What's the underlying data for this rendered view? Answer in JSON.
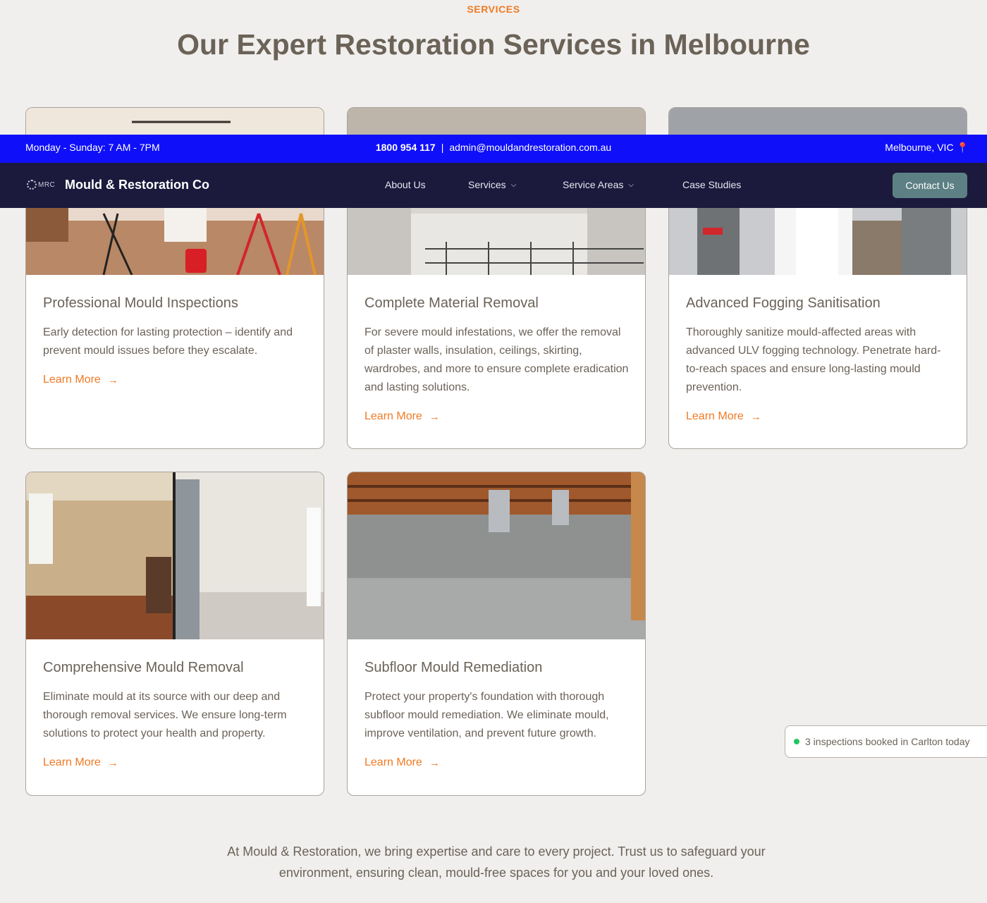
{
  "section": {
    "eyebrow": "SERVICES",
    "headline": "Our Expert Restoration Services in Melbourne"
  },
  "topbar": {
    "hours": "Monday - Sunday: 7 AM - 7PM",
    "phone": "1800 954 117",
    "separator": "|",
    "email": "admin@mouldandrestoration.com.au",
    "location": "Melbourne, VIC",
    "location_icon": "map-pin-icon"
  },
  "navbar": {
    "logo_text": "MRC",
    "brand": "Mould & Restoration Co",
    "items": [
      {
        "label": "About Us",
        "dropdown": false
      },
      {
        "label": "Services",
        "dropdown": true
      },
      {
        "label": "Service Areas",
        "dropdown": true
      },
      {
        "label": "Case Studies",
        "dropdown": false
      }
    ],
    "cta": "Contact Us",
    "chevron": "⌄"
  },
  "services": [
    {
      "title": "Professional Mould Inspections",
      "description": "Early detection for lasting protection – identify and prevent mould issues before they escalate.",
      "link": "Learn More"
    },
    {
      "title": "Complete Material Removal",
      "description": "For severe mould infestations, we offer the removal of plaster walls, insulation, ceilings, skirting, wardrobes, and more to ensure complete eradication and lasting solutions.",
      "link": "Learn More"
    },
    {
      "title": "Advanced Fogging Sanitisation",
      "description": "Thoroughly sanitize mould-affected areas with advanced ULV fogging technology. Penetrate hard-to-reach spaces and ensure long-lasting mould prevention.",
      "link": "Learn More"
    },
    {
      "title": "Comprehensive Mould Removal",
      "description": "Eliminate mould at its source with our deep and thorough removal services. We ensure long-term solutions to protect your health and property.",
      "link": "Learn More"
    },
    {
      "title": "Subfloor Mould Remediation",
      "description": "Protect your property's foundation with thorough subfloor mould remediation. We eliminate mould, improve ventilation, and prevent future growth.",
      "link": "Learn More"
    }
  ],
  "arrow": "→",
  "toast": {
    "text": "3 inspections booked in Carlton today",
    "status_color": "#22c55e"
  },
  "footer": {
    "text": "At Mould & Restoration, we bring expertise and care to every project. Trust us to safeguard your environment, ensuring clean, mould-free spaces for you and your loved ones."
  },
  "colors": {
    "accent": "#f07a24",
    "topbar": "#0f0ff9",
    "navbar": "#1b1a3d",
    "cta": "#5c8083",
    "background": "#f0efed"
  }
}
